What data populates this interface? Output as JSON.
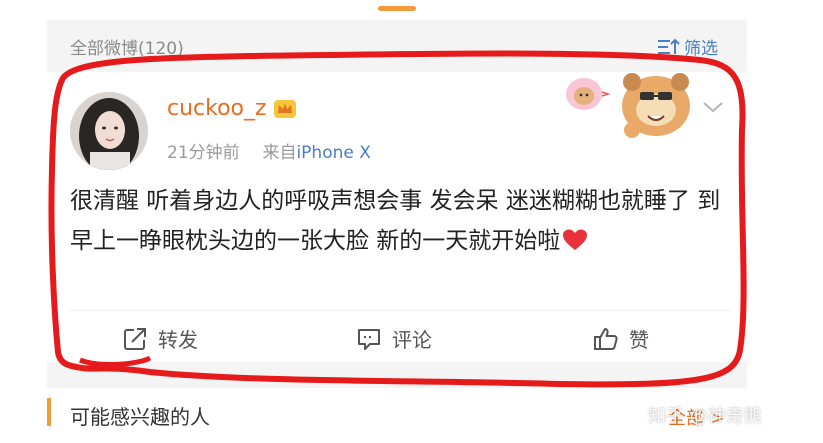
{
  "feed_header": {
    "title": "全部微博(120)",
    "filter_label": "筛选"
  },
  "post": {
    "username": "cuckoo_z",
    "time": "21分钟前",
    "source_prefix": "来自",
    "source": "iPhone X",
    "text": "很清醒 听着身边人的呼吸声想会事 发会呆 迷迷糊糊也就睡了 到早上一睁眼枕头边的一张大脸 新的一天就开始啦",
    "actions": {
      "repost": "转发",
      "comment": "评论",
      "like": "赞"
    }
  },
  "section": {
    "title": "可能感兴趣的人",
    "more": "全部"
  },
  "watermark": "知乎 @神奇熊",
  "colors": {
    "accent": "#e86d1f",
    "link": "#4a7fc4",
    "annotation": "#e51a1a"
  },
  "icons": [
    "filter-icon",
    "crown-icon",
    "chevron-down-icon",
    "heart-icon",
    "repost-icon",
    "comment-icon",
    "like-icon",
    "bear-sticker-icon",
    "right-arrow-icon"
  ]
}
